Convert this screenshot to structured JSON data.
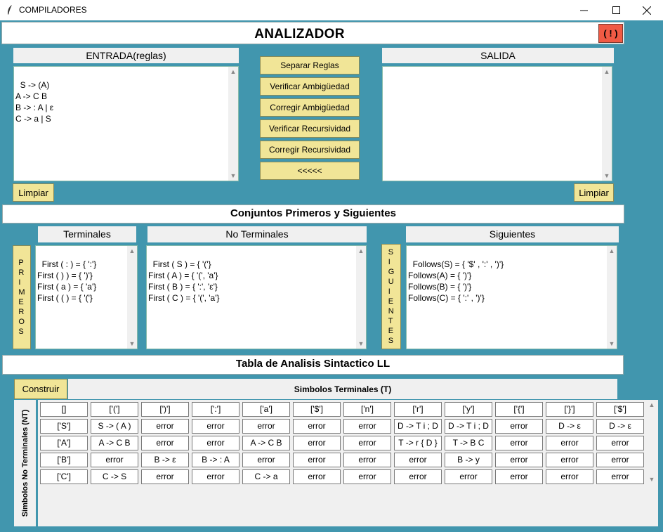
{
  "window": {
    "title": "COMPILADORES"
  },
  "header": {
    "title": "ANALIZADOR",
    "alert_label": "( ! )"
  },
  "input_panel": {
    "label": "ENTRADA(reglas)",
    "text": "S -> (A)\nA -> C B\nB -> : A | ε\nC -> a | S",
    "clear_label": "Limpiar"
  },
  "actions": [
    "Separar Reglas",
    "Verificar Ambigüedad",
    "Corregir  Ambigüedad",
    "Verificar Recursividad",
    "Corregir  Recursividad",
    "<<<<<"
  ],
  "output_panel": {
    "label": "SALIDA",
    "text": "",
    "clear_label": "Limpiar"
  },
  "sets_section": {
    "title": "Conjuntos Primeros y Siguientes",
    "terminales_label": "Terminales",
    "no_terminales_label": "No Terminales",
    "siguientes_label": "Siguientes",
    "primeros_button": "PRIMEROS",
    "siguientes_button": "SIGUIENTES",
    "terminales_text": "First ( : ) = { ':'}\nFirst ( ) ) = { ')'}\nFirst ( a ) = { 'a'}\nFirst ( ( ) = { '('}",
    "no_terminales_text": "First ( S ) = { '('}\nFirst ( A ) = { '(', 'a'}\nFirst ( B ) = { ':', 'ε'}\nFirst ( C ) = { '(', 'a'}",
    "siguientes_text": "Follows(S) = { '$' , ':' , ')'}\nFollows(A) = { ')'}\nFollows(B) = { ')'}\nFollows(C) = { ':' , ')'}"
  },
  "ll_table": {
    "title": "Tabla de Analisis Sintactico LL",
    "build_label": "Construir",
    "terminals_label": "Simbolos Terminales (T)",
    "nonterminals_label": "Simbolos No Terminales (NT)",
    "rows": [
      [
        "[]",
        "['(']",
        "[')']",
        "[':']",
        "['a']",
        "['$']",
        "['n']",
        "['r']",
        "['y']",
        "['{']",
        "['}']",
        "['$']"
      ],
      [
        "['S']",
        "S -> ( A )",
        "error",
        "error",
        "error",
        "error",
        "error",
        "D -> T i ; D",
        "D -> T i ; D",
        "error",
        "D -> ε",
        "D -> ε"
      ],
      [
        "['A']",
        "A -> C B",
        "error",
        "error",
        "A -> C B",
        "error",
        "error",
        "T -> r { D }",
        "T -> B C",
        "error",
        "error",
        "error"
      ],
      [
        "['B']",
        "error",
        "B -> ε",
        "B -> : A",
        "error",
        "error",
        "error",
        "error",
        "B -> y",
        "error",
        "error",
        "error"
      ],
      [
        "['C']",
        "C -> S",
        "error",
        "error",
        "C -> a",
        "error",
        "error",
        "error",
        "error",
        "error",
        "error",
        "error"
      ]
    ]
  }
}
